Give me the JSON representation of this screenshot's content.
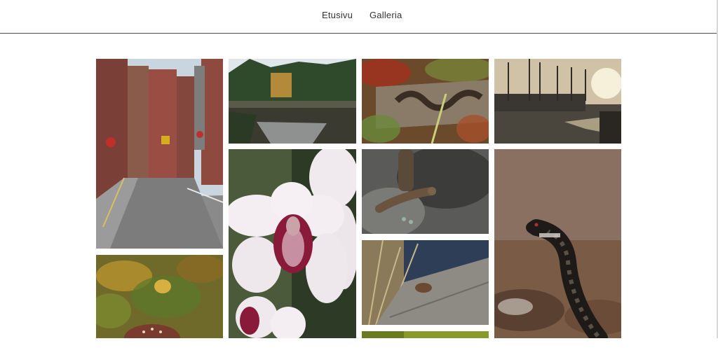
{
  "nav": {
    "home_label": "Etusivu",
    "gallery_label": "Galleria"
  },
  "colors": {
    "background": "#ffffff",
    "nav_text": "#333333",
    "divider": "#4a4a4a"
  }
}
